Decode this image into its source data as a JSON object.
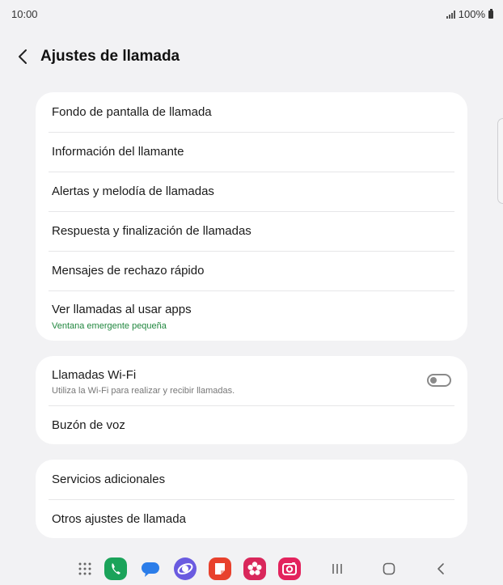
{
  "status": {
    "time": "10:00",
    "battery": "100%"
  },
  "header": {
    "title": "Ajustes de llamada"
  },
  "group1": [
    {
      "title": "Fondo de pantalla de llamada"
    },
    {
      "title": "Información del llamante"
    },
    {
      "title": "Alertas y melodía de llamadas"
    },
    {
      "title": "Respuesta y finalización de llamadas"
    },
    {
      "title": "Mensajes de rechazo rápido"
    },
    {
      "title": "Ver llamadas al usar apps",
      "subtitle": "Ventana emergente pequeña"
    }
  ],
  "group2": [
    {
      "title": "Llamadas Wi-Fi",
      "subtitle": "Utiliza la Wi-Fi para realizar y recibir llamadas.",
      "toggle_on": false
    },
    {
      "title": "Buzón de voz"
    }
  ],
  "group3": [
    {
      "title": "Servicios adicionales"
    },
    {
      "title": "Otros ajustes de llamada"
    }
  ],
  "colors": {
    "accent_green": "#21873f",
    "background": "#f2f2f4",
    "card": "#ffffff"
  },
  "nav": {
    "apps": [
      "apps-grid-icon",
      "phone-icon",
      "messages-icon",
      "internet-icon",
      "notes-icon",
      "gallery-icon",
      "camera-icon"
    ],
    "buttons": [
      "recents-icon",
      "home-icon",
      "back-icon"
    ]
  }
}
